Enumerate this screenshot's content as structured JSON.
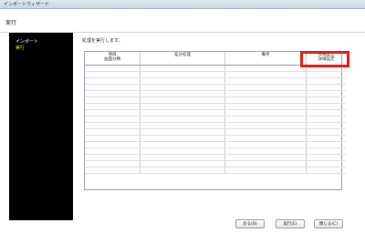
{
  "window": {
    "title": "インポートウィザード"
  },
  "header": {
    "title": "実行"
  },
  "sidebar": {
    "items": [
      {
        "label": "インポート"
      },
      {
        "label": "実行"
      }
    ]
  },
  "main": {
    "instruction": "処理を実行します。",
    "table": {
      "columns": [
        {
          "label": "項目",
          "sublabel": "画面分類"
        },
        {
          "label": "差分処理",
          "sublabel": ""
        },
        {
          "label": "備考",
          "sublabel": ""
        },
        {
          "label": "詳細設定",
          "sublabel": "詳細設定"
        }
      ],
      "row_count": 17
    }
  },
  "footer": {
    "buttons": [
      {
        "label": "戻る(B)"
      },
      {
        "label": "実行(E)"
      },
      {
        "label": "閉じる(C)"
      }
    ]
  },
  "colors": {
    "sidebar_bg": "#000000",
    "sidebar_active": "#f3e600",
    "highlight": "#ee1c1c"
  }
}
